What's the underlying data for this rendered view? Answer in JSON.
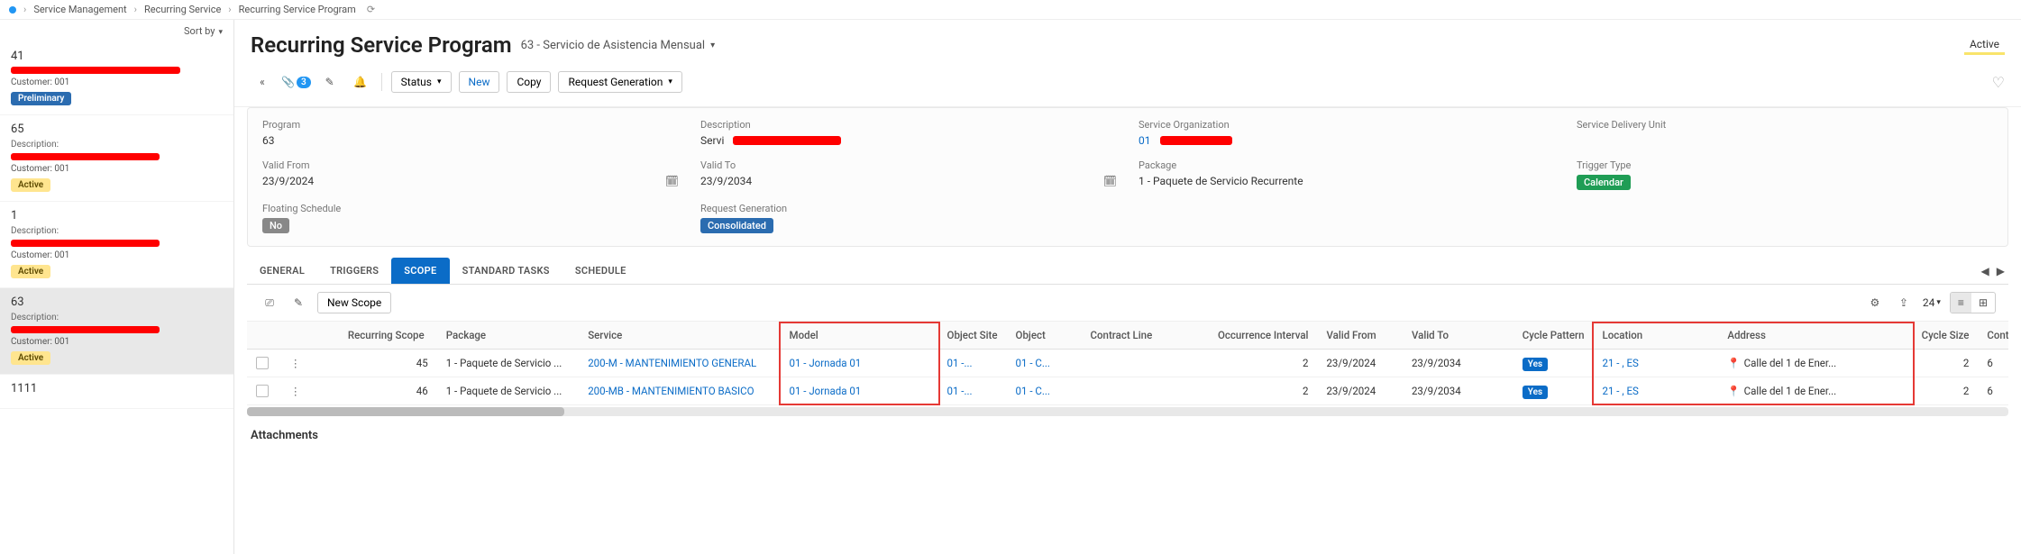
{
  "breadcrumb": {
    "items": [
      "Service Management",
      "Recurring Service",
      "Recurring Service Program"
    ]
  },
  "sidebar": {
    "sort_label": "Sort by",
    "items": [
      {
        "num": "41",
        "desc_label": "",
        "cust": "Customer:  001",
        "badge": "Preliminary",
        "badge_class": "badge-prelim"
      },
      {
        "num": "65",
        "desc_label": "Description:",
        "cust": "Customer:  001",
        "badge": "Active",
        "badge_class": "badge-active"
      },
      {
        "num": "1",
        "desc_label": "Description:",
        "cust": "Customer:  001",
        "badge": "Active",
        "badge_class": "badge-active"
      },
      {
        "num": "63",
        "desc_label": "Description:",
        "cust": "Customer:  001",
        "badge": "Active",
        "badge_class": "badge-active",
        "selected": true
      },
      {
        "num": "1111",
        "desc_label": "",
        "cust": "",
        "badge": "",
        "badge_class": ""
      }
    ]
  },
  "header": {
    "title": "Recurring Service Program",
    "subtitle": "63 - Servicio de Asistencia Mensual",
    "status": "Active"
  },
  "toolbar": {
    "attach_count": "3",
    "status_label": "Status",
    "new_label": "New",
    "copy_label": "Copy",
    "reqgen_label": "Request Generation"
  },
  "info": {
    "program_label": "Program",
    "program_val": "63",
    "description_label": "Description",
    "description_val": "Servi",
    "org_label": "Service Organization",
    "org_val": "01",
    "sdu_label": "Service Delivery Unit",
    "sdu_val": "",
    "validfrom_label": "Valid From",
    "validfrom_val": "23/9/2024",
    "validto_label": "Valid To",
    "validto_val": "23/9/2034",
    "package_label": "Package",
    "package_val": "1 - Paquete de Servicio Recurrente",
    "trigger_label": "Trigger Type",
    "trigger_val": "Calendar",
    "floating_label": "Floating Schedule",
    "floating_val": "No",
    "reqgen_label": "Request Generation",
    "reqgen_val": "Consolidated"
  },
  "tabs": {
    "items": [
      "GENERAL",
      "TRIGGERS",
      "SCOPE",
      "STANDARD TASKS",
      "SCHEDULE"
    ],
    "active": 2
  },
  "scope_toolbar": {
    "new_scope": "New Scope",
    "page_size": "24"
  },
  "table": {
    "cols": [
      "",
      "",
      "",
      "Recurring Scope",
      "Package",
      "Service",
      "Model",
      "",
      "Object Site",
      "Object",
      "Contract Line",
      "",
      "Occurrence Interval",
      "Valid From",
      "Valid To",
      "",
      "Cycle Pattern",
      "Location",
      "Address",
      "",
      "Cycle Size",
      "Contract ID"
    ],
    "rows": [
      {
        "scope": "45",
        "package": "1 - Paquete de Servicio ...",
        "service": "200-M - MANTENIMIENTO GENERAL",
        "model": "01 - Jornada 01",
        "osite": "01 -...",
        "object": "01 - C...",
        "cline": "",
        "occ": "2",
        "vfrom": "23/9/2024",
        "vto": "23/9/2034",
        "pattern": "Yes",
        "location": "21 - , ES",
        "address": "Calle del 1 de Ener...",
        "csize": "2",
        "cid": "6"
      },
      {
        "scope": "46",
        "package": "1 - Paquete de Servicio ...",
        "service": "200-MB - MANTENIMIENTO BASICO",
        "model": "01 - Jornada 01",
        "osite": "01 -...",
        "object": "01 - C...",
        "cline": "",
        "occ": "2",
        "vfrom": "23/9/2024",
        "vto": "23/9/2034",
        "pattern": "Yes",
        "location": "21 - , ES",
        "address": "Calle del 1 de Ener...",
        "csize": "2",
        "cid": "6"
      }
    ]
  },
  "attachments_hdr": "Attachments"
}
